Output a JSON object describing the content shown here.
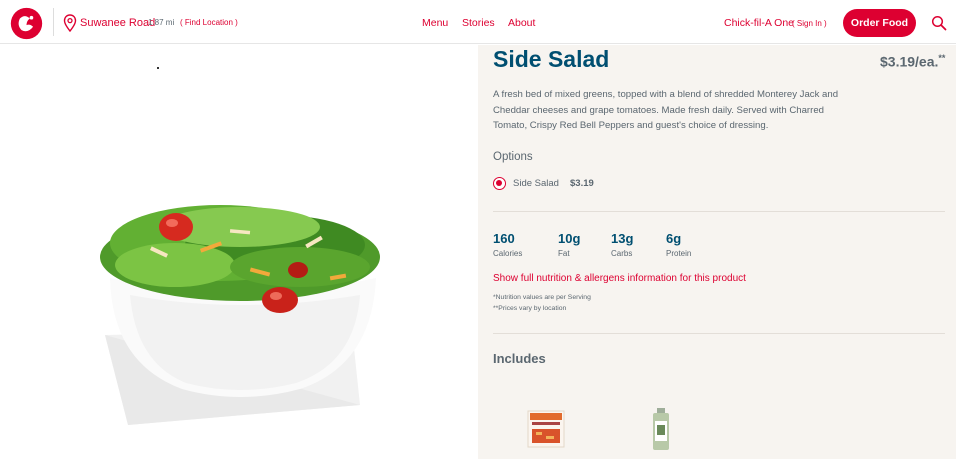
{
  "header": {
    "location_name": "Suwanee Road",
    "location_distance": "1.87 mi",
    "find_location": "( Find Location )",
    "nav": [
      "Menu",
      "Stories",
      "About"
    ],
    "one_label": "Chick-fil-A One",
    "sign_in": "( Sign In )",
    "order_button": "Order Food",
    "brand_color": "#dd0031"
  },
  "product": {
    "title": "Side Salad",
    "price": "$3.19/ea.",
    "price_mark": "**",
    "description": "A fresh bed of mixed greens, topped with a blend of shredded Monterey Jack and Cheddar cheeses and grape tomatoes. Made fresh daily. Served with Charred Tomato, Crispy Red Bell Peppers and guest's choice of dressing.",
    "options_heading": "Options",
    "option": {
      "name": "Side Salad",
      "price": "$3.19",
      "selected": true
    },
    "nutrition": [
      {
        "value": "160",
        "label": "Calories"
      },
      {
        "value": "10g",
        "label": "Fat"
      },
      {
        "value": "13g",
        "label": "Carbs"
      },
      {
        "value": "6g",
        "label": "Protein"
      }
    ],
    "nutrition_link": "Show full nutrition & allergens information for this product",
    "notes": [
      "*Nutrition values are per Serving",
      "**Prices vary by location"
    ],
    "includes_heading": "Includes",
    "includes": [
      "charred-tomato-crispy-peppers-packet",
      "dressing-bottle"
    ]
  }
}
